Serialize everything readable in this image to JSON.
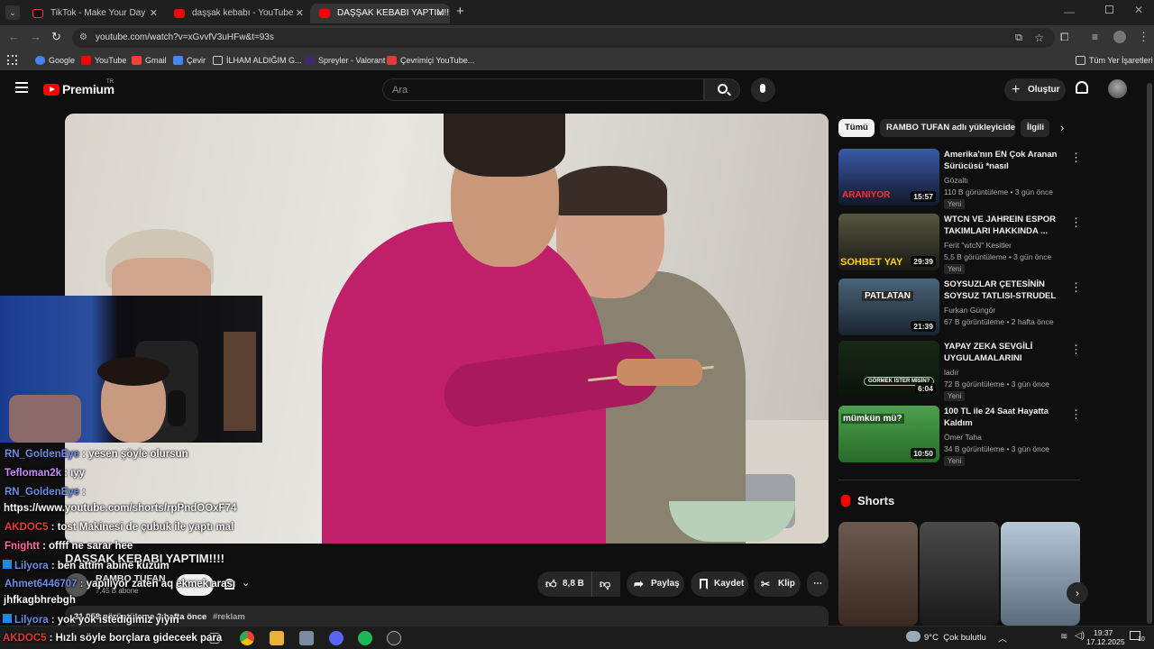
{
  "browser": {
    "tabs": [
      {
        "title": "TikTok - Make Your Day",
        "color": "#fe2c55"
      },
      {
        "title": "daşşak kebabı - YouTube",
        "color": "#ff0000"
      },
      {
        "title": "DAŞŞAK KEBABI YAPTIM!!!! - YouTube",
        "color": "#ff0000"
      }
    ],
    "new_tab": "+",
    "url": "youtube.com/watch?v=xGvvfV3uHFw&t=93s",
    "bookmarks": [
      {
        "label": "Google",
        "color": "#4285f4"
      },
      {
        "label": "YouTube",
        "color": "#ff0000"
      },
      {
        "label": "Gmail",
        "color": "#ea4335"
      },
      {
        "label": "Çevir",
        "color": "#4285f4"
      },
      {
        "label": "İLHAM ALDIĞIM G...",
        "color": "#9aa0a6"
      },
      {
        "label": "Spreyler - Valorant",
        "color": "#3d2a6e"
      },
      {
        "label": "Çevrimiçi YouTube...",
        "color": "#e53935"
      }
    ],
    "all_bookmarks": "Tüm Yer İşaretleri"
  },
  "youtube": {
    "logo": "Premium",
    "logo_suffix": "TR",
    "search_placeholder": "Ara",
    "create_label": "Oluştur"
  },
  "video": {
    "title": "DAŞŞAK KEBABI YAPTIM!!!!",
    "channel": "RAMBO TUFAN",
    "subscribers": "7,45 B abone",
    "subscribe_label": "Abone ol",
    "likes": "8,8 B",
    "share_label": "Paylaş",
    "save_label": "Kaydet",
    "clip_label": "Klip",
    "desc_meta": "31.058 görüntüleme  2 hafta önce",
    "desc_tag": "#reklam"
  },
  "stream_chat": [
    {
      "user": "RN_GoldenEye",
      "color": "#6b8de3",
      "text": ": yesen şöyle olursun"
    },
    {
      "user": "Tefloman2k",
      "color": "#c98bff",
      "text": ": ıyy"
    },
    {
      "user": "RN_GoldenEye",
      "color": "#6b8de3",
      "text": ":"
    },
    {
      "user": "",
      "color": "#ffffff",
      "text": "https://www.youtube.com/shorts/rpPndOOxF74"
    },
    {
      "user": "AKDOC5",
      "color": "#e53935",
      "text": ": tost Makinesi de çubuk ile yaptı mal"
    },
    {
      "user": "Fnightt",
      "color": "#ff6b9a",
      "text": ": offff ne sarar hee"
    },
    {
      "user": "Lilyora",
      "color": "#6b8de3",
      "text": ": ben attım abine kuzum"
    },
    {
      "user": "Ahmet6446707",
      "color": "#6b8de3",
      "text": ": yapılıyor zaten aq ekmek arası"
    },
    {
      "user": "",
      "color": "#ffffff",
      "text": "jhfkagbhrebgh"
    },
    {
      "user": "Lilyora",
      "color": "#6b8de3",
      "text": ": yok yok istediğimiz yiyin"
    },
    {
      "user": "AKDOC5",
      "color": "#e53935",
      "text": ": Hızlı söyle borçlara gideceek para"
    }
  ],
  "sidebar": {
    "chips": [
      "Tümü",
      "RAMBO TUFAN adlı yükleyiciden",
      "İlgili"
    ],
    "recs": [
      {
        "title": "Amerika'nın EN Çok Aranan Sürücüsü *nasıl yakalanmıyor?*",
        "channel": "Gözaltı",
        "stats": "110 B görüntüleme • 3 gün önce",
        "badge": "Yeni",
        "duration": "15:57",
        "thumb_text": "ARANIYOR",
        "color": "#1b2a4a"
      },
      {
        "title": "WTCN VE JAHREIN ESPOR TAKIMLARI HAKKINDA ...",
        "channel": "Ferit \"wtcN\" Kesitler",
        "stats": "5,5 B görüntüleme • 3 gün önce",
        "badge": "Yeni",
        "duration": "29:39",
        "thumb_text": "SOHBET YAY",
        "color": "#3a3a2a"
      },
      {
        "title": "SOYSUZLAR ÇETESİNİN SOYSUZ TATLISI-STRUDEL ...",
        "channel": "Furkan Güngör",
        "stats": "67 B görüntüleme • 2 hafta önce",
        "badge": "",
        "duration": "21:39",
        "thumb_text": "PATLATAN",
        "color": "#2a3d4a"
      },
      {
        "title": "YAPAY ZEKA SEVGİLİ UYGULAMALARINI DENEDİM",
        "channel": "ladır",
        "stats": "72 B görüntüleme • 3 gün önce",
        "badge": "Yeni",
        "duration": "6:04",
        "thumb_text": "GÖRMEK İSTER MİSİN?",
        "color": "#1e2a1e"
      },
      {
        "title": "100 TL ile 24 Saat Hayatta Kaldım",
        "channel": "Ömer Taha",
        "stats": "34 B görüntüleme • 3 gün önce",
        "badge": "Yeni",
        "duration": "10:50",
        "thumb_text": "mümkün mü?",
        "color": "#3c8c3c"
      }
    ],
    "shorts_title": "Shorts"
  },
  "taskbar": {
    "weather": "9°C  Çok bulutlu",
    "time": "19:37",
    "date": "17.12.2025",
    "notif": "10"
  }
}
